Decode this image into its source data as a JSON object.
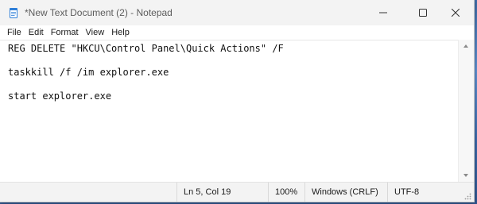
{
  "window": {
    "title": "*New Text Document (2) - Notepad",
    "app_icon": "notepad-icon"
  },
  "caption_buttons": {
    "minimize_icon": "minimize-icon",
    "maximize_icon": "maximize-icon",
    "close_icon": "close-icon"
  },
  "menu": {
    "items": [
      "File",
      "Edit",
      "Format",
      "View",
      "Help"
    ]
  },
  "editor": {
    "lines": [
      "REG DELETE \"HKCU\\Control Panel\\Quick Actions\" /F",
      "taskkill /f /im explorer.exe",
      "start explorer.exe"
    ]
  },
  "statusbar": {
    "position": "Ln 5, Col 19",
    "zoom": "100%",
    "line_ending": "Windows (CRLF)",
    "encoding": "UTF-8"
  },
  "colors": {
    "accent": "#2f7fd8",
    "titlebar": "#f3f3f3",
    "desktop": "#4a78b8"
  }
}
